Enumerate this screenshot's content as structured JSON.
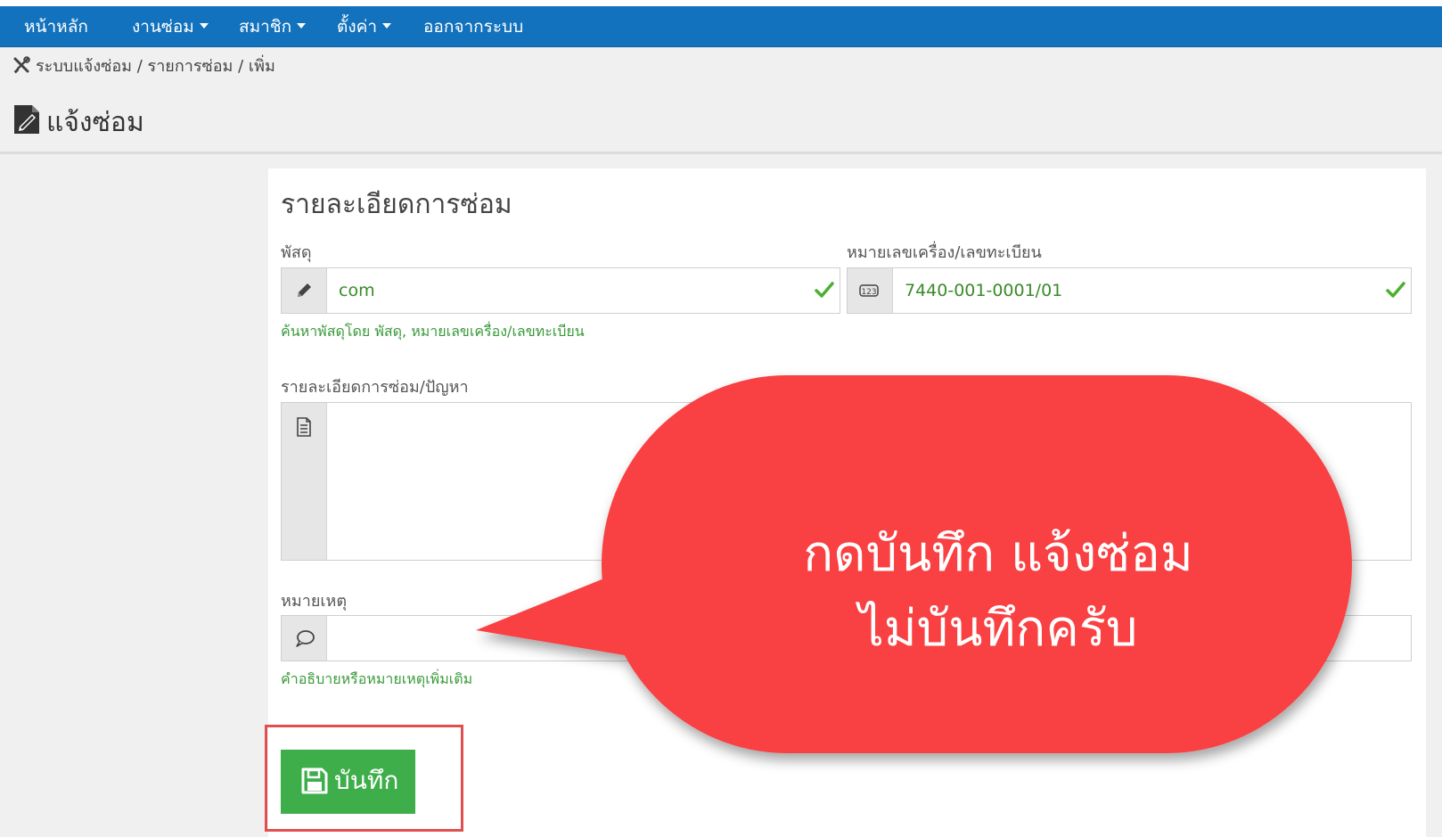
{
  "nav": {
    "items": [
      {
        "label": "หน้าหลัก",
        "dropdown": false
      },
      {
        "label": "งานซ่อม",
        "dropdown": true
      },
      {
        "label": "สมาชิก",
        "dropdown": true
      },
      {
        "label": "ตั้งค่า",
        "dropdown": true
      },
      {
        "label": "ออกจากระบบ",
        "dropdown": false
      }
    ]
  },
  "breadcrumb": {
    "icon": "tools-icon",
    "text": "ระบบแจ้งซ่อม / รายการซ่อม / เพิ่ม"
  },
  "page": {
    "title": "แจ้งซ่อม",
    "title_icon": "document-edit-icon"
  },
  "form": {
    "section_title": "รายละเอียดการซ่อม",
    "item": {
      "label": "พัสดุ",
      "value": "com",
      "icon": "pencil-icon",
      "hint": "ค้นหาพัสดุโดย พัสดุ, หมายเลขเครื่อง/เลขทะเบียน"
    },
    "serial": {
      "label": "หมายเลขเครื่อง/เลขทะเบียน",
      "value": "7440-001-0001/01",
      "icon": "number-123-icon",
      "icon_text": "123"
    },
    "detail": {
      "label": "รายละเอียดการซ่อม/ปัญหา",
      "value": "",
      "icon": "document-icon"
    },
    "note": {
      "label": "หมายเหตุ",
      "value": "",
      "icon": "speech-bubble-icon",
      "hint": "คำอธิบายหรือหมายเหตุเพิ่มเติม"
    },
    "save_label": "บันทึก"
  },
  "callout": {
    "line1": "กดบันทึก แจ้งซ่อม",
    "line2": "ไม่บันทึกครับ",
    "color": "#f94143"
  },
  "colors": {
    "navbar": "#1272bd",
    "valid_text": "#3a8a2a",
    "save_button": "#3eae4a",
    "highlight_border": "#e05050"
  }
}
